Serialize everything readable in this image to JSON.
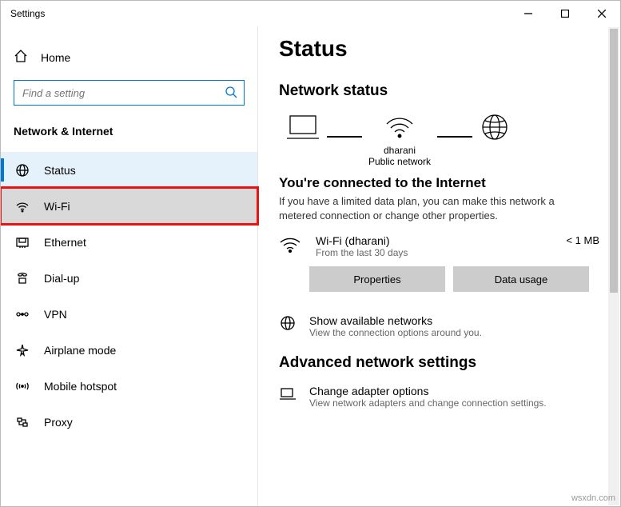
{
  "titlebar": {
    "title": "Settings"
  },
  "sidebar": {
    "home": "Home",
    "search_placeholder": "Find a setting",
    "section": "Network & Internet",
    "items": [
      {
        "label": "Status"
      },
      {
        "label": "Wi-Fi"
      },
      {
        "label": "Ethernet"
      },
      {
        "label": "Dial-up"
      },
      {
        "label": "VPN"
      },
      {
        "label": "Airplane mode"
      },
      {
        "label": "Mobile hotspot"
      },
      {
        "label": "Proxy"
      }
    ]
  },
  "main": {
    "title": "Status",
    "network_status": "Network status",
    "diagram": {
      "ssid": "dharani",
      "net_type": "Public network"
    },
    "connected": {
      "title": "You're connected to the Internet",
      "desc": "If you have a limited data plan, you can make this network a metered connection or change other properties."
    },
    "wifi": {
      "name": "Wi-Fi (dharani)",
      "sub": "From the last 30 days",
      "usage": "< 1 MB"
    },
    "buttons": {
      "properties": "Properties",
      "data_usage": "Data usage"
    },
    "available": {
      "title": "Show available networks",
      "sub": "View the connection options around you."
    },
    "advanced_header": "Advanced network settings",
    "adapter": {
      "title": "Change adapter options",
      "sub": "View network adapters and change connection settings."
    }
  },
  "watermark": "wsxdn.com"
}
